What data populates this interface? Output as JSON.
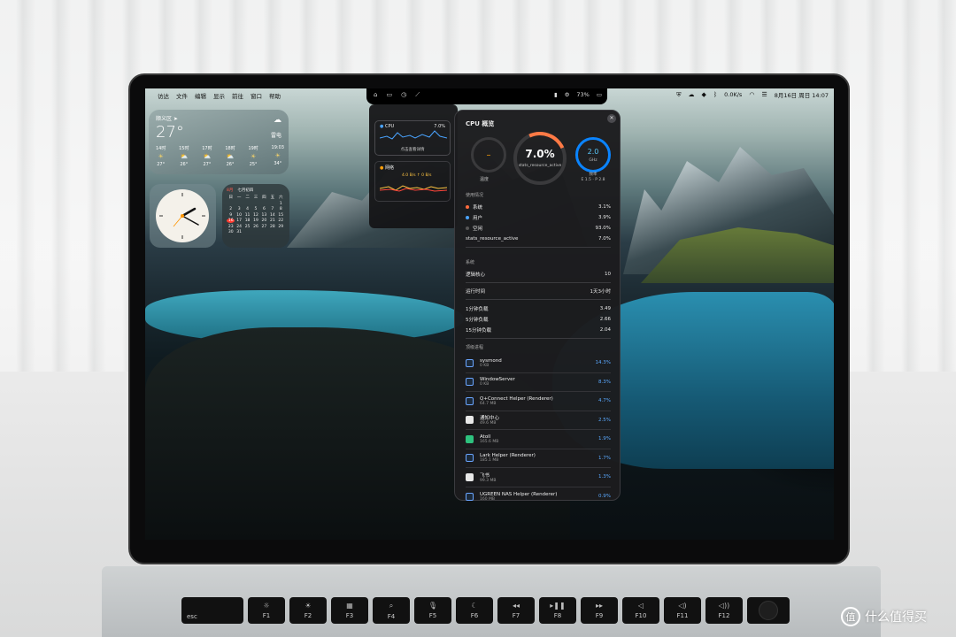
{
  "menubar": {
    "apple": "",
    "items": [
      "访达",
      "文件",
      "编辑",
      "显示",
      "前往",
      "窗口",
      "帮助"
    ],
    "battery_pct": "73%",
    "net_rate": "0.0K/s",
    "date_time": "8月16日 周日 14:07"
  },
  "weather": {
    "location": "顺义区 ➤",
    "temp": "27°",
    "condition": "雷电",
    "hours": [
      {
        "time": "14时",
        "temp": "27°"
      },
      {
        "time": "15时",
        "temp": "26°"
      },
      {
        "time": "17时",
        "temp": "27°"
      },
      {
        "time": "18时",
        "temp": "26°"
      },
      {
        "time": "19时",
        "temp": "25°"
      },
      {
        "time": "19:03",
        "temp": "34°"
      }
    ]
  },
  "calendar": {
    "month": "8月",
    "lunar": "七月初四",
    "weekdays": [
      "日",
      "一",
      "二",
      "三",
      "四",
      "五",
      "六"
    ],
    "days": [
      "",
      "",
      "",
      "",
      "",
      "",
      "1",
      "2",
      "3",
      "4",
      "5",
      "6",
      "7",
      "8",
      "9",
      "10",
      "11",
      "12",
      "13",
      "14",
      "15",
      "16",
      "17",
      "18",
      "19",
      "20",
      "21",
      "22",
      "23",
      "24",
      "25",
      "26",
      "27",
      "28",
      "29",
      "30",
      "31"
    ],
    "today": "16"
  },
  "mini_panel": {
    "cpu_label": "CPU",
    "cpu_value": "7.0%",
    "hint": "点击查看详情",
    "net_label": "网络",
    "net_rates": "4.0 B/s  ↑ 0 B/s"
  },
  "cpu_panel": {
    "title": "CPU 概览",
    "temp_value": "–",
    "temp_label": "温度",
    "usage_value": "7.0%",
    "usage_sub": "stats_resource_active",
    "freq_value": "2.0",
    "freq_unit": "GHz",
    "freq_label": "频率",
    "freq_sub": "E 1.5 · P 2.8",
    "usage_section": "使用情况",
    "usage_rows": [
      {
        "label": "系统",
        "value": "3.1%",
        "color": "#ff6b3d"
      },
      {
        "label": "用户",
        "value": "3.9%",
        "color": "#4aa3ff"
      },
      {
        "label": "空闲",
        "value": "93.0%",
        "color": "#555555"
      },
      {
        "label": "stats_resource_active",
        "value": "7.0%",
        "color": ""
      }
    ],
    "system_section": "系统",
    "system_rows": [
      {
        "label": "逻辑核心",
        "value": "10"
      },
      {
        "label": "运行时间",
        "value": "1天3小时"
      }
    ],
    "load_rows": [
      {
        "label": "1分钟负载",
        "value": "3.49"
      },
      {
        "label": "5分钟负载",
        "value": "2.66"
      },
      {
        "label": "15分钟负载",
        "value": "2.04"
      }
    ],
    "process_section": "顶级进程",
    "processes": [
      {
        "name": "sysmond",
        "mem": "0 KB",
        "cpu": "14.3%",
        "icon": "generic"
      },
      {
        "name": "WindowServer",
        "mem": "0 KB",
        "cpu": "8.3%",
        "icon": "generic"
      },
      {
        "name": "Q+Connect Helper (Renderer)",
        "mem": "64.7 MB",
        "cpu": "4.7%",
        "icon": "generic"
      },
      {
        "name": "通知中心",
        "mem": "49.6 MB",
        "cpu": "2.5%",
        "icon": "white"
      },
      {
        "name": "Atoll",
        "mem": "165.6 MB",
        "cpu": "1.9%",
        "icon": "green"
      },
      {
        "name": "Lark Helper (Renderer)",
        "mem": "185.1 MB",
        "cpu": "1.7%",
        "icon": "generic"
      },
      {
        "name": "飞书",
        "mem": "99.3 MB",
        "cpu": "1.3%",
        "icon": "white"
      },
      {
        "name": "UGREEN NAS Helper (Renderer)",
        "mem": "160 MB",
        "cpu": "0.9%",
        "icon": "generic"
      }
    ]
  },
  "keyboard": {
    "keys": [
      "esc",
      "F1",
      "F2",
      "F3",
      "F4",
      "F5",
      "F6",
      "F7",
      "F8",
      "F9",
      "F10",
      "F11",
      "F12"
    ],
    "glyphs": [
      "",
      "☼",
      "☀",
      "▦",
      "⌕",
      "🎙",
      "☾",
      "◂◂",
      "▸❚❚",
      "▸▸",
      "◁",
      "◁)",
      "◁))"
    ]
  },
  "watermark": {
    "logo": "值",
    "text": "什么值得买"
  }
}
